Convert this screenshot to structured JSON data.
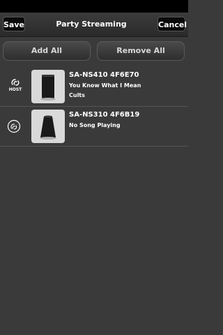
{
  "header": {
    "save_label": "Save",
    "title": "Party Streaming",
    "cancel_label": "Cancel"
  },
  "actions": {
    "add_all_label": "Add All",
    "remove_all_label": "Remove All"
  },
  "devices": [
    {
      "name": "SA-NS410 4F6E70",
      "line1": "You Know What I Mean",
      "line2": "Cults",
      "role_label": "HOST",
      "icon": "host-link-icon"
    },
    {
      "name": "SA-NS310 4F6B19",
      "line1": "No Song Playing",
      "icon": "link-icon"
    }
  ],
  "colors": {
    "background": "#3a3a3a",
    "button_dark": "#0a0a0a",
    "text": "#ffffff"
  }
}
